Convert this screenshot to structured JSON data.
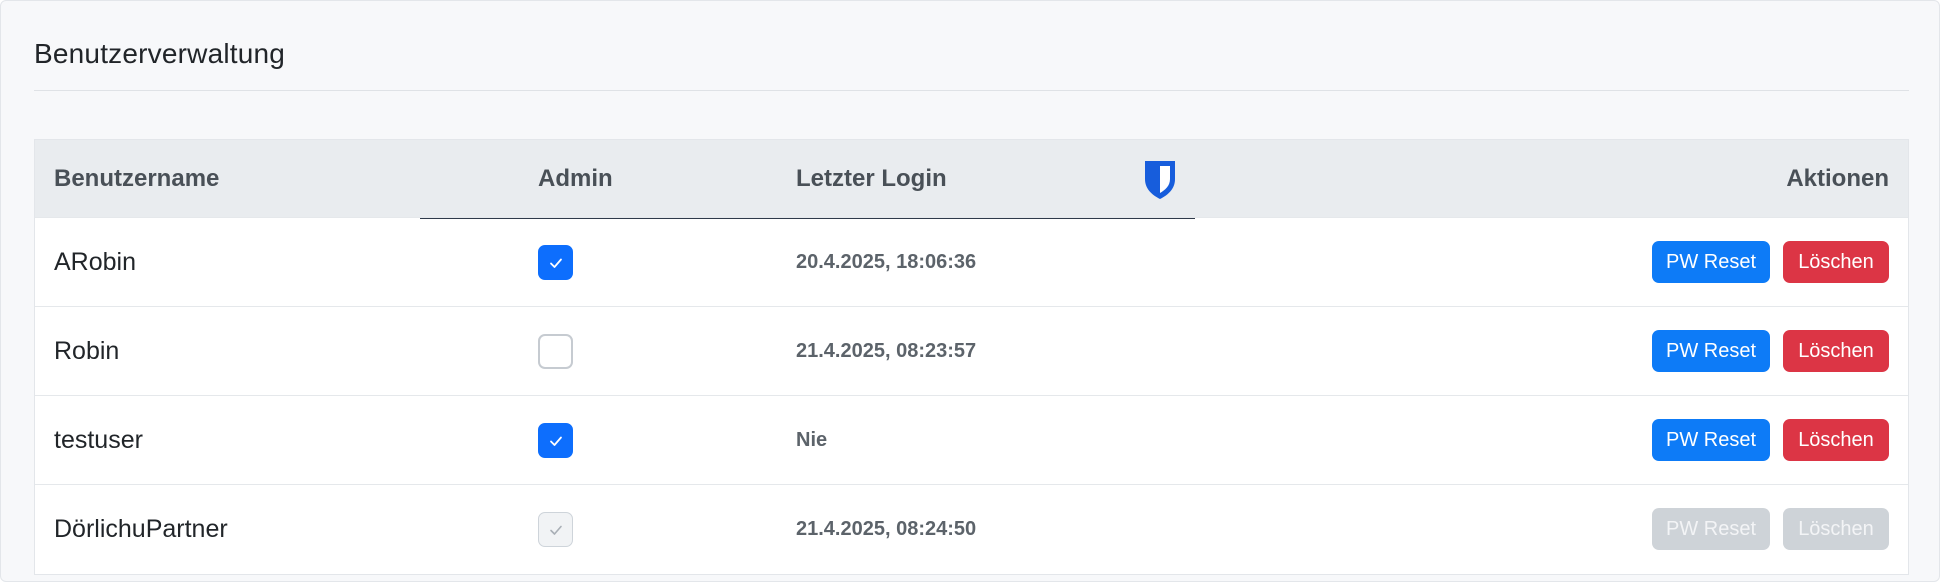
{
  "page": {
    "title": "Benutzerverwaltung"
  },
  "table": {
    "headers": {
      "username": "Benutzername",
      "admin": "Admin",
      "last_login": "Letzter Login",
      "actions": "Aktionen"
    },
    "rows": [
      {
        "username": "ARobin",
        "admin": true,
        "admin_disabled": false,
        "last_login": "20.4.2025, 18:06:36",
        "reset_label": "PW Reset",
        "delete_label": "Löschen",
        "actions_disabled": false
      },
      {
        "username": "Robin",
        "admin": false,
        "admin_disabled": false,
        "last_login": "21.4.2025, 08:23:57",
        "reset_label": "PW Reset",
        "delete_label": "Löschen",
        "actions_disabled": false
      },
      {
        "username": "testuser",
        "admin": true,
        "admin_disabled": false,
        "last_login": "Nie",
        "reset_label": "PW Reset",
        "delete_label": "Löschen",
        "actions_disabled": false
      },
      {
        "username": "DörlichuPartner",
        "admin": true,
        "admin_disabled": true,
        "last_login": "21.4.2025, 08:24:50",
        "reset_label": "PW Reset",
        "delete_label": "Löschen",
        "actions_disabled": true
      }
    ]
  },
  "icons": {
    "header_extension_icon": "bitwarden-shield-icon",
    "checkmark": "check-icon"
  },
  "colors": {
    "primary": "#0d7bf7",
    "danger": "#dc3545",
    "disabled": "#ced3d8",
    "shield": "#175ddc"
  }
}
